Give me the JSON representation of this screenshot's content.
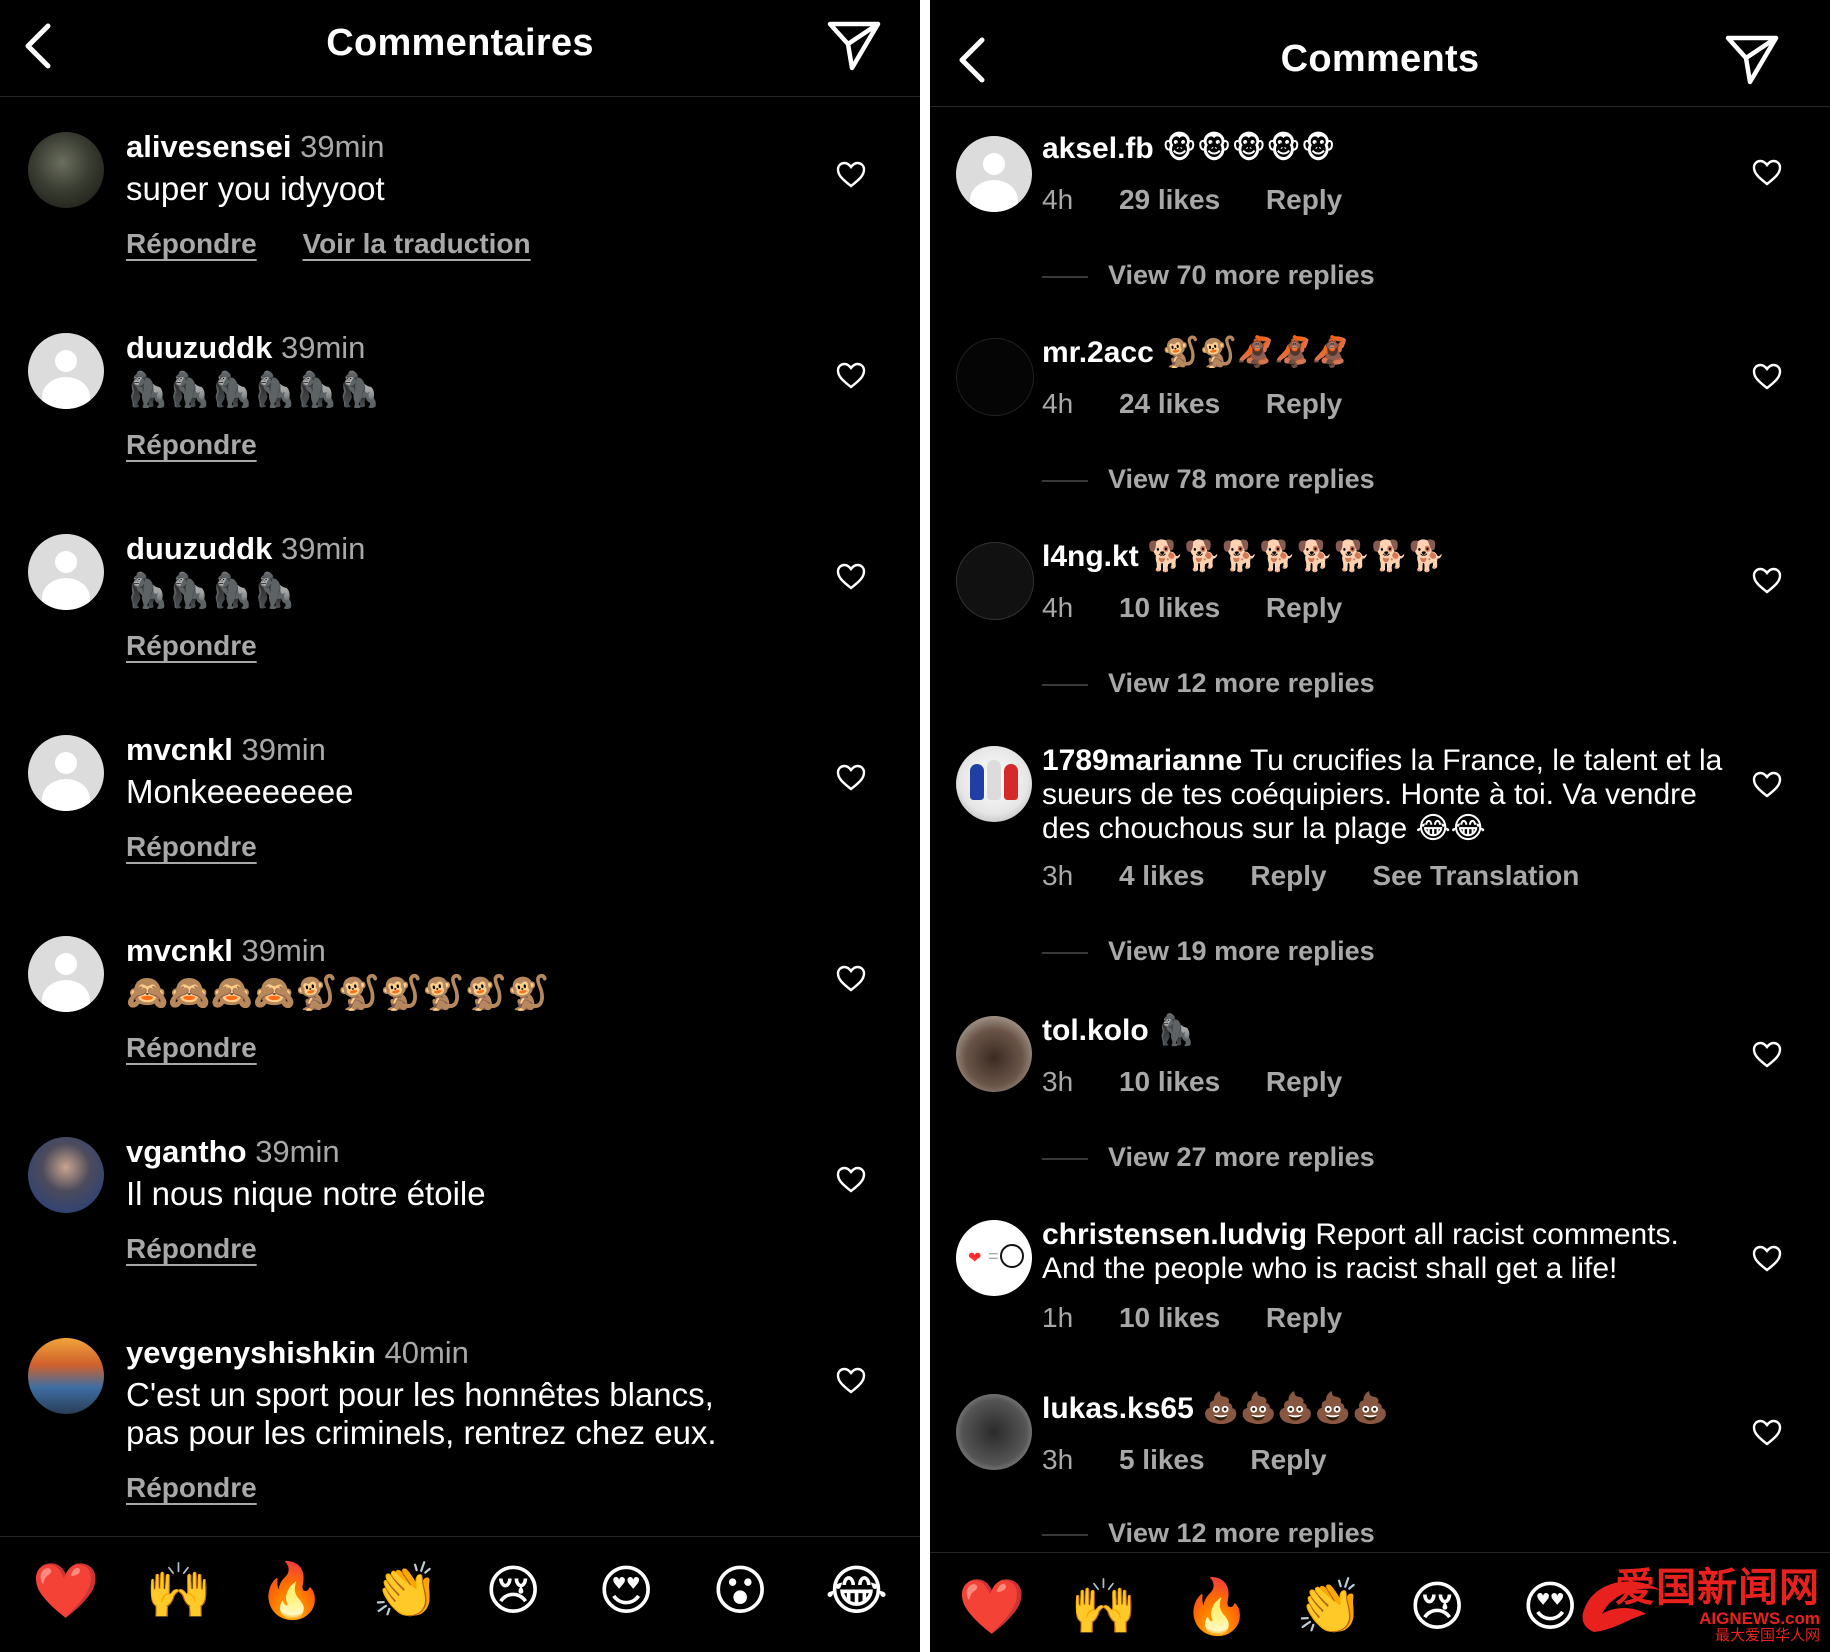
{
  "left": {
    "title": "Commentaires",
    "reply_label": "Répondre",
    "translate_label": "Voir la traduction",
    "comments": [
      {
        "username": "alivesensei",
        "time": "39min",
        "text": "super you idyyoot"
      },
      {
        "username": "duuzuddk",
        "time": "39min",
        "text": "🦍🦍🦍🦍🦍🦍"
      },
      {
        "username": "duuzuddk",
        "time": "39min",
        "text": "🦍🦍🦍🦍"
      },
      {
        "username": "mvcnkl",
        "time": "39min",
        "text": "Monkeeeeeeee"
      },
      {
        "username": "mvcnkl",
        "time": "39min",
        "text": "🙈🙈🙈🙈🐒🐒🐒🐒🐒🐒"
      },
      {
        "username": "vgantho",
        "time": "39min",
        "text": "Il nous nique notre étoile"
      },
      {
        "username": "yevgenyshishkin",
        "time": "40min",
        "text": "C'est un sport pour les honnêtes blancs, pas pour les criminels, rentrez chez eux."
      }
    ],
    "reactions": [
      "❤️",
      "🙌",
      "🔥",
      "👏",
      "😢",
      "😍",
      "😮",
      "😂"
    ]
  },
  "right": {
    "title": "Comments",
    "reply_label": "Reply",
    "see_translation_label": "See Translation",
    "comments": [
      {
        "username": "aksel.fb",
        "text": "🐵🐵🐵🐵🐵",
        "time": "4h",
        "likes": "29 likes",
        "view_more": "View 70 more replies"
      },
      {
        "username": "mr.2acc",
        "text": "🐒🐒🦧🦧🦧",
        "time": "4h",
        "likes": "24 likes",
        "view_more": "View 78 more replies"
      },
      {
        "username": "l4ng.kt",
        "text": "🐕🐕🐕🐕🐕🐕🐕🐕",
        "time": "4h",
        "likes": "10 likes",
        "view_more": "View 12 more replies"
      },
      {
        "username": "1789marianne",
        "text": "Tu crucifies la France, le talent et la sueurs de tes coéquipiers. Honte à toi. Va vendre des chouchous sur la plage 😂😂",
        "time": "3h",
        "likes": "4 likes",
        "view_more": "View 19 more replies"
      },
      {
        "username": "tol.kolo",
        "text": "🦍",
        "time": "3h",
        "likes": "10 likes",
        "view_more": "View 27 more replies"
      },
      {
        "username": "christensen.ludvig",
        "text": "Report all racist comments. And the people who is racist shall get a life!",
        "time": "1h",
        "likes": "10 likes",
        "view_more": ""
      },
      {
        "username": "lukas.ks65",
        "text": "💩💩💩💩💩",
        "time": "3h",
        "likes": "5 likes",
        "view_more": "View 12 more replies"
      }
    ],
    "reactions": [
      "❤️",
      "🙌",
      "🔥",
      "👏",
      "😢",
      "😍"
    ]
  },
  "watermark": {
    "title": "爱国新闻网",
    "url": "AIGNEWS.com",
    "subtitle": "最大爱国华人网"
  },
  "colors": {
    "background": "#000000",
    "text": "#ffffff",
    "muted": "#a8a8a8",
    "watermark": "#e8211f"
  }
}
